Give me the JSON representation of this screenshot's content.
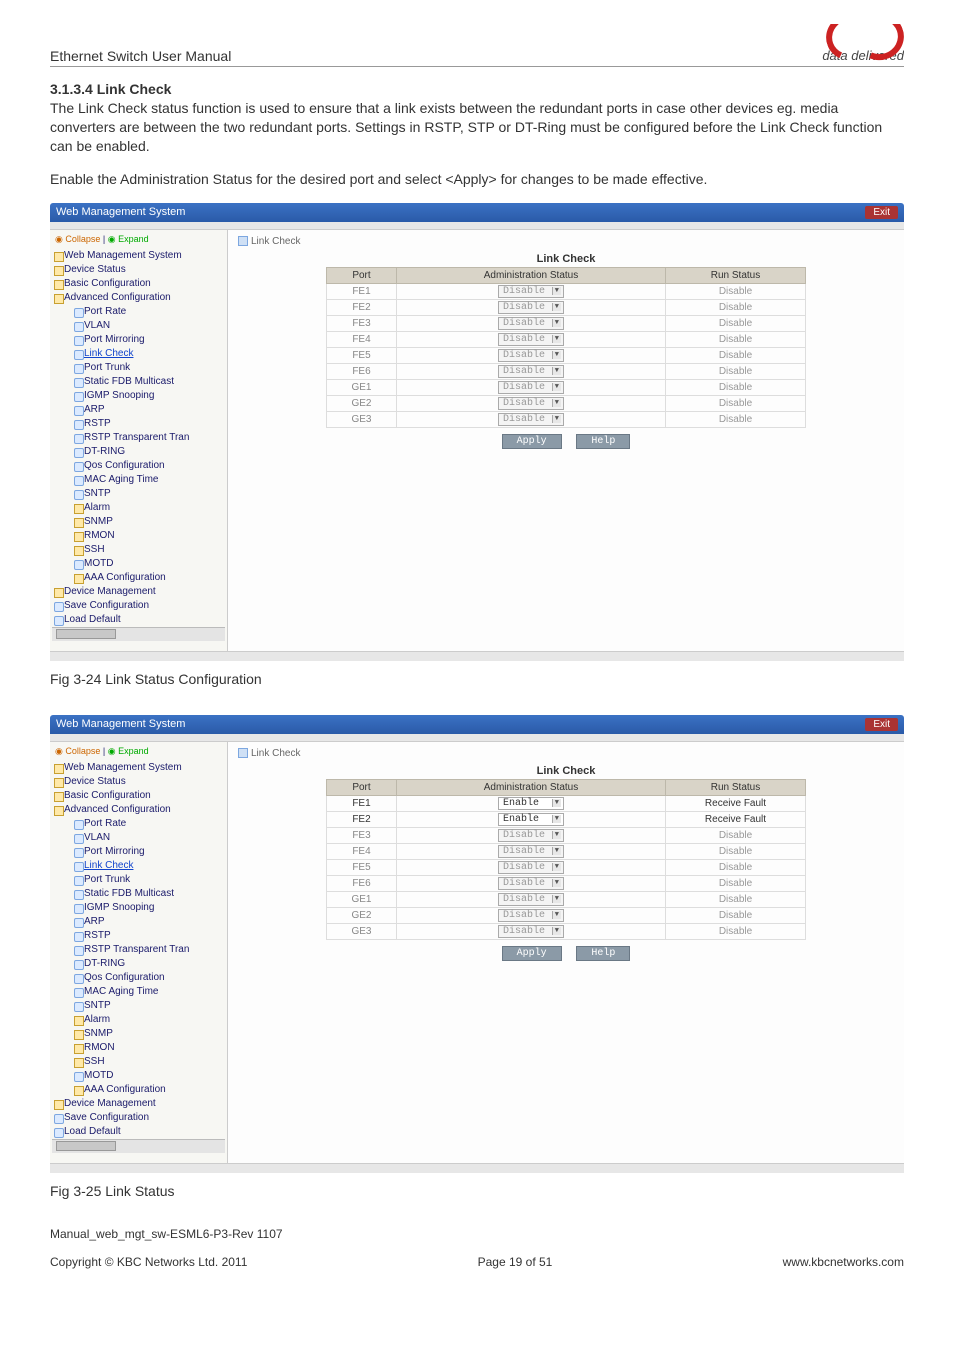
{
  "header": {
    "logo_tag": "data delivered",
    "doc_title": "Ethernet Switch User Manual"
  },
  "section": {
    "heading": "3.1.3.4 Link Check",
    "para1": " The Link Check status function is used to ensure that a link exists between the redundant ports in case other devices eg. media converters are between the two redundant ports. Settings in RSTP, STP or DT-Ring must be configured before the Link Check function can be enabled.",
    "para2": "Enable the Administration Status for the desired port and select <Apply> for changes to be made effective."
  },
  "app": {
    "titlebar": "Web Management System",
    "exit": "Exit",
    "collapse_label": "Collapse",
    "expand_label": "Expand",
    "crumb": "Link Check",
    "panel_title": "Link Check",
    "columns": {
      "port": "Port",
      "admin": "Administration Status",
      "run": "Run Status"
    },
    "apply": "Apply",
    "help": "Help",
    "tree_top": "Web Management System",
    "tree": [
      "Device Status",
      "Basic Configuration",
      "Advanced Configuration",
      "Device Management",
      "Save Configuration",
      "Load Default"
    ],
    "adv_children": [
      "Port Rate",
      "VLAN",
      "Port Mirroring",
      "Link Check",
      "Port Trunk",
      "Static FDB Multicast",
      "IGMP Snooping",
      "ARP",
      "RSTP",
      "RSTP Transparent Tran",
      "DT-RING",
      "Qos Configuration",
      "MAC Aging Time",
      "SNTP",
      "Alarm",
      "SNMP",
      "RMON",
      "SSH",
      "MOTD",
      "AAA Configuration"
    ]
  },
  "tbl1": {
    "rows": [
      {
        "port": "FE1",
        "admin": "Disable",
        "run": "Disable"
      },
      {
        "port": "FE2",
        "admin": "Disable",
        "run": "Disable"
      },
      {
        "port": "FE3",
        "admin": "Disable",
        "run": "Disable"
      },
      {
        "port": "FE4",
        "admin": "Disable",
        "run": "Disable"
      },
      {
        "port": "FE5",
        "admin": "Disable",
        "run": "Disable"
      },
      {
        "port": "FE6",
        "admin": "Disable",
        "run": "Disable"
      },
      {
        "port": "GE1",
        "admin": "Disable",
        "run": "Disable"
      },
      {
        "port": "GE2",
        "admin": "Disable",
        "run": "Disable"
      },
      {
        "port": "GE3",
        "admin": "Disable",
        "run": "Disable"
      }
    ]
  },
  "tbl2": {
    "rows": [
      {
        "port": "FE1",
        "admin": "Enable",
        "run": "Receive Fault",
        "active": true
      },
      {
        "port": "FE2",
        "admin": "Enable",
        "run": "Receive Fault",
        "active": true
      },
      {
        "port": "FE3",
        "admin": "Disable",
        "run": "Disable"
      },
      {
        "port": "FE4",
        "admin": "Disable",
        "run": "Disable"
      },
      {
        "port": "FE5",
        "admin": "Disable",
        "run": "Disable"
      },
      {
        "port": "FE6",
        "admin": "Disable",
        "run": "Disable"
      },
      {
        "port": "GE1",
        "admin": "Disable",
        "run": "Disable"
      },
      {
        "port": "GE2",
        "admin": "Disable",
        "run": "Disable"
      },
      {
        "port": "GE3",
        "admin": "Disable",
        "run": "Disable"
      }
    ]
  },
  "captions": {
    "fig1": "Fig 3-24 Link Status Configuration",
    "fig2": "Fig 3-25 Link Status"
  },
  "footer": {
    "manual_id": "Manual_web_mgt_sw-ESML6-P3-Rev 1107",
    "copyright": "Copyright © KBC Networks Ltd. 2011",
    "page": "Page 19 of 51",
    "url": "www.kbcnetworks.com"
  }
}
